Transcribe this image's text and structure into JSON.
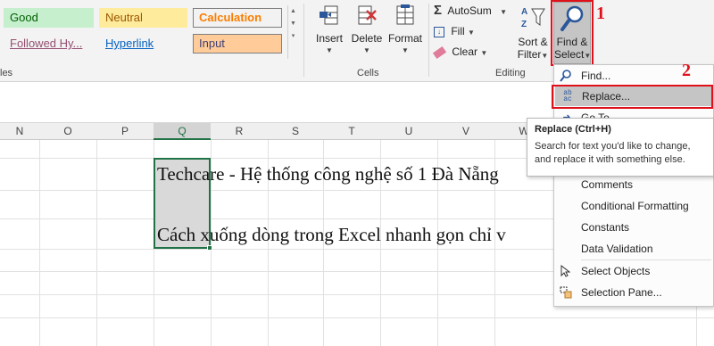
{
  "styles": {
    "good": "Good",
    "neutral": "Neutral",
    "calculation": "Calculation",
    "followed_hyperlink": "Followed Hy...",
    "hyperlink": "Hyperlink",
    "input": "Input"
  },
  "cells_group": {
    "insert": "Insert",
    "delete": "Delete",
    "format": "Format",
    "label": "Cells"
  },
  "editing_group": {
    "autosum": "AutoSum",
    "fill": "Fill",
    "clear": "Clear",
    "sort_filter_1": "Sort &",
    "sort_filter_2": "Filter",
    "find_select_1": "Find &",
    "find_select_2": "Select",
    "label": "Editing"
  },
  "left_label": "les",
  "columns": [
    "N",
    "O",
    "P",
    "Q",
    "R",
    "S",
    "T",
    "U",
    "V",
    "W"
  ],
  "cells": {
    "line1": "Techcare - Hệ thống công nghệ số 1 Đà Nẵng",
    "line2": "Cách xuống dòng trong Excel nhanh gọn chỉ v"
  },
  "menu": {
    "find": "Find...",
    "replace": "Replace...",
    "goto": "Go To...",
    "comments": "Comments",
    "conditional_formatting": "Conditional Formatting",
    "constants": "Constants",
    "data_validation": "Data Validation",
    "select_objects": "Select Objects",
    "selection_pane": "Selection Pane..."
  },
  "tooltip": {
    "title": "Replace (Ctrl+H)",
    "body": "Search for text you'd like to change, and replace it with something else."
  },
  "annotations": {
    "one": "1",
    "two": "2"
  },
  "colors": {
    "good_bg": "#c6efce",
    "good_fg": "#006100",
    "neutral_bg": "#ffeb9c",
    "neutral_fg": "#9c5700",
    "calc_bg": "#f2f2f2",
    "calc_fg": "#fa7d00",
    "input_bg": "#ffcc99",
    "input_fg": "#3f3f76",
    "excel_green": "#217346",
    "annotation_red": "#e0101a"
  }
}
